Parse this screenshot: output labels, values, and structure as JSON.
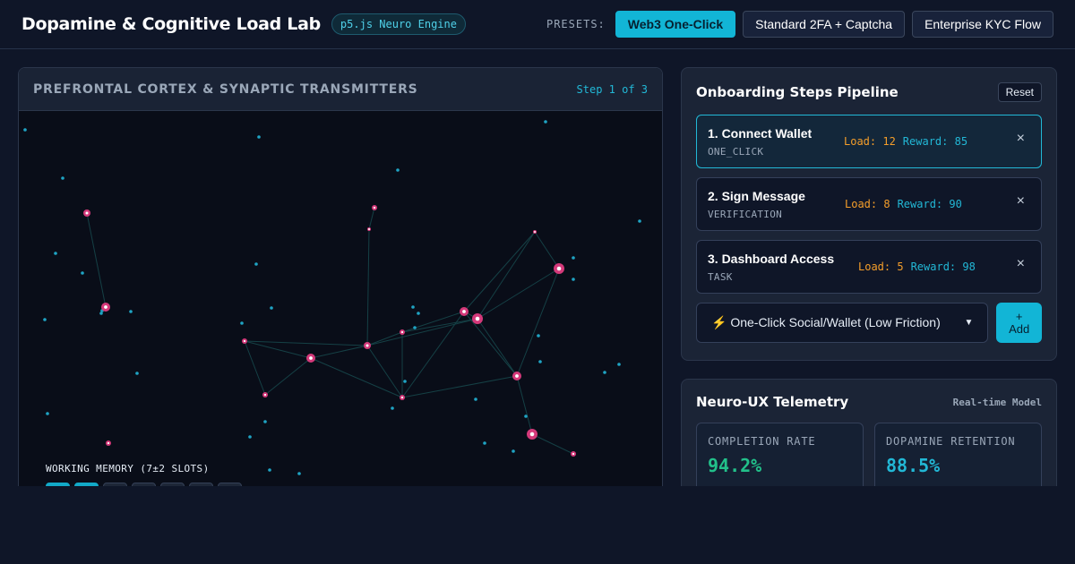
{
  "header": {
    "title": "Dopamine & Cognitive Load Lab",
    "engine_badge": "p5.js Neuro Engine",
    "presets_label": "PRESETS:",
    "presets": [
      {
        "label": "Web3 One-Click",
        "active": true
      },
      {
        "label": "Standard 2FA + Captcha",
        "active": false
      },
      {
        "label": "Enterprise KYC Flow",
        "active": false
      }
    ]
  },
  "brain": {
    "title": "PREFRONTAL CORTEX & SYNAPTIC TRANSMITTERS",
    "step_indicator": "Step 1 of 3",
    "working_memory_label": "WORKING MEMORY (7±2 SLOTS)",
    "working_memory_filled": 2,
    "working_memory_slots": 7
  },
  "pipeline": {
    "title": "Onboarding Steps Pipeline",
    "reset_label": "Reset",
    "steps": [
      {
        "name": "1. Connect Wallet",
        "type": "ONE_CLICK",
        "load": "Load: 12",
        "reward": "Reward: 85",
        "active": true
      },
      {
        "name": "2. Sign Message",
        "type": "VERIFICATION",
        "load": "Load: 8",
        "reward": "Reward: 90",
        "active": false
      },
      {
        "name": "3. Dashboard Access",
        "type": "TASK",
        "load": "Load: 5",
        "reward": "Reward: 98",
        "active": false
      }
    ],
    "remove_glyph": "×",
    "select_value": "⚡ One-Click Social/Wallet (Low Friction)",
    "add_label_plus": "+",
    "add_label": "Add"
  },
  "telemetry": {
    "title": "Neuro-UX Telemetry",
    "subtitle": "Real-time Model",
    "metrics": [
      {
        "label": "COMPLETION RATE",
        "value": "94.2%",
        "color": "#22c08a"
      },
      {
        "label": "DOPAMINE RETENTION",
        "value": "88.5%",
        "color": "#22b8d6"
      }
    ]
  },
  "colors": {
    "accent": "#12b5d6",
    "synapse": "#d4397a",
    "particle": "#1fa4c4",
    "load": "#f59e2a"
  }
}
